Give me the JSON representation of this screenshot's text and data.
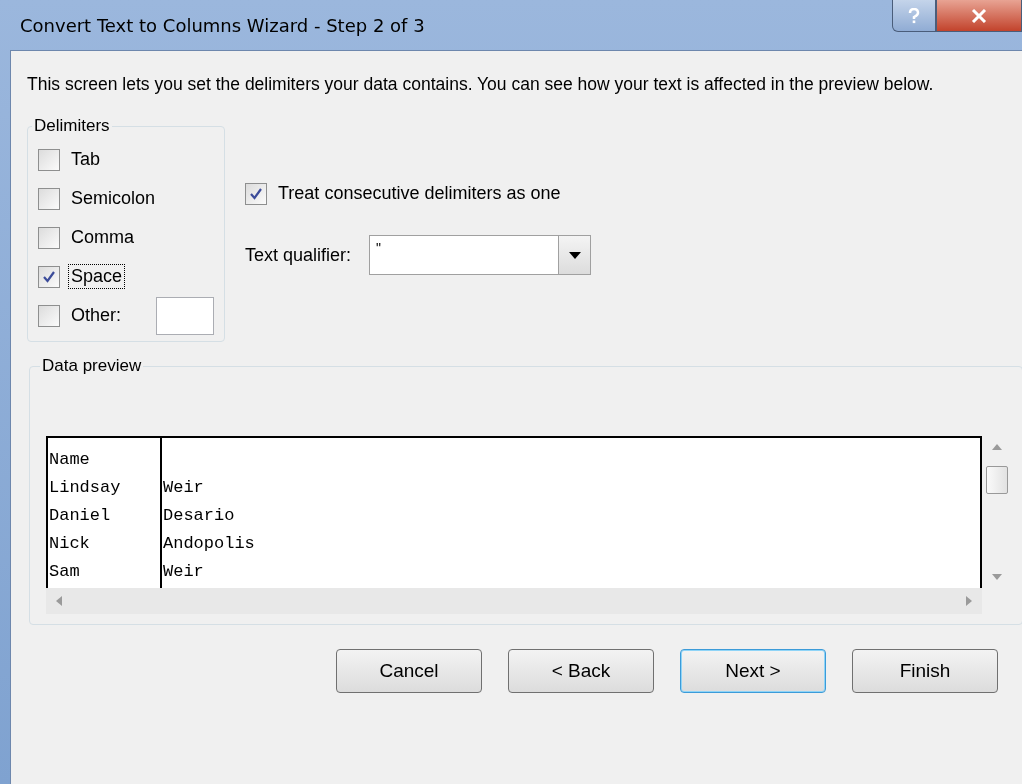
{
  "window": {
    "title": "Convert Text to Columns Wizard - Step 2 of 3"
  },
  "intro": "This screen lets you set the delimiters your data contains.  You can see how your text is affected in the preview below.",
  "delimiters": {
    "title": "Delimiters",
    "items": [
      {
        "label": "Tab",
        "checked": false,
        "focused": false
      },
      {
        "label": "Semicolon",
        "checked": false,
        "focused": false
      },
      {
        "label": "Comma",
        "checked": false,
        "focused": false
      },
      {
        "label": "Space",
        "checked": true,
        "focused": true
      },
      {
        "label": "Other:",
        "checked": false,
        "focused": false,
        "kind": "other"
      }
    ]
  },
  "consecutive": {
    "label": "Treat consecutive delimiters as one",
    "checked": true
  },
  "qualifier": {
    "label": "Text qualifier:",
    "value": "\""
  },
  "preview": {
    "title": "Data preview",
    "rows": [
      [
        "Name"
      ],
      [
        "Lindsay",
        "Weir"
      ],
      [
        "Daniel",
        "Desario"
      ],
      [
        "Nick",
        "Andopolis"
      ],
      [
        "Sam",
        "Weir"
      ]
    ]
  },
  "buttons": [
    {
      "label": "Cancel",
      "default": false
    },
    {
      "label": "< Back",
      "default": false
    },
    {
      "label": "Next >",
      "default": true
    },
    {
      "label": "Finish",
      "default": false
    }
  ]
}
